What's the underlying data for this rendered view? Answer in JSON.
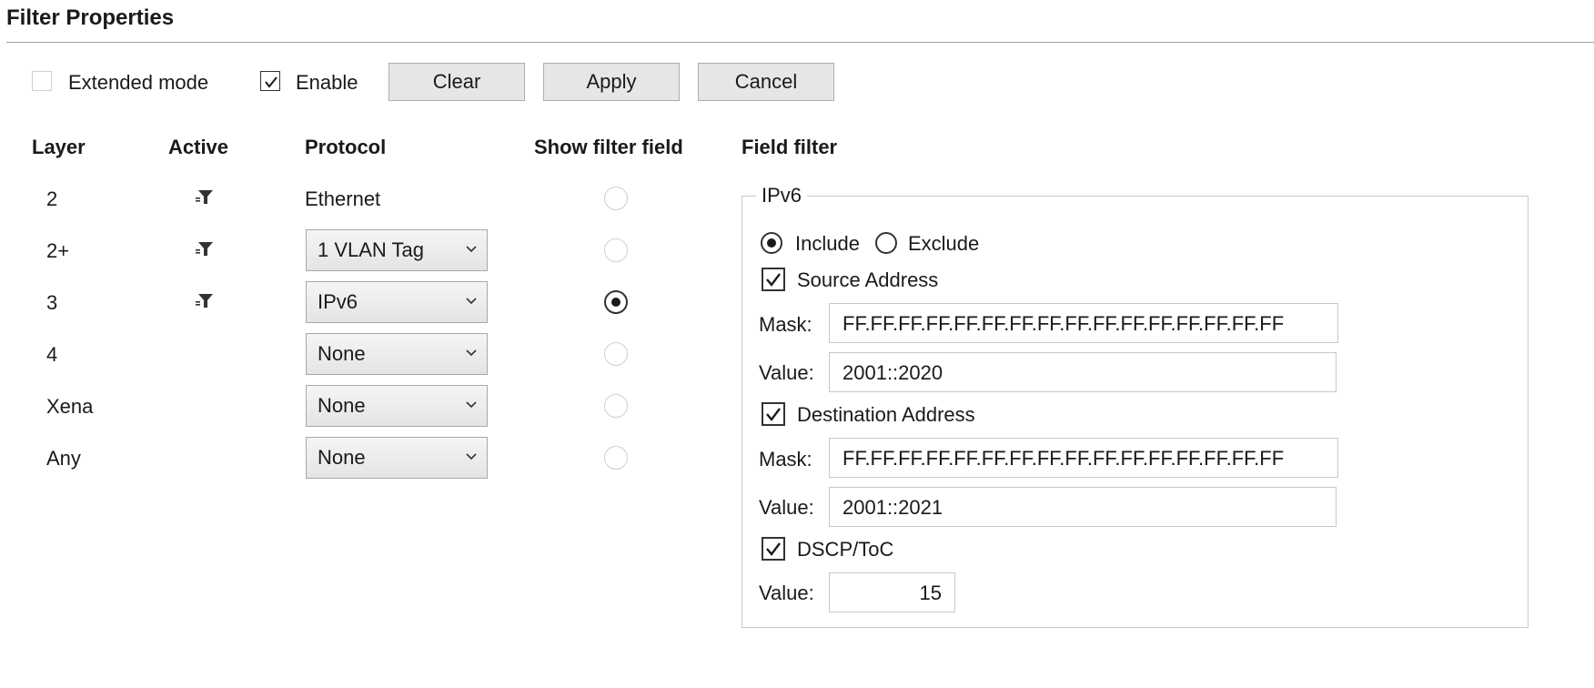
{
  "header": {
    "title": "Filter Properties"
  },
  "toolbar": {
    "extended_mode": {
      "label": "Extended mode",
      "checked": false
    },
    "enable": {
      "label": "Enable",
      "checked": true
    },
    "clear_label": "Clear",
    "apply_label": "Apply",
    "cancel_label": "Cancel"
  },
  "columns": {
    "layer": "Layer",
    "active": "Active",
    "protocol": "Protocol",
    "show_filter_field": "Show filter field",
    "field_filter": "Field filter"
  },
  "rows": [
    {
      "layer": "2",
      "active": true,
      "protocol": "Ethernet",
      "protocol_is_dropdown": false,
      "show_filter_field": false
    },
    {
      "layer": "2+",
      "active": true,
      "protocol": "1 VLAN Tag",
      "protocol_is_dropdown": true,
      "show_filter_field": false
    },
    {
      "layer": "3",
      "active": true,
      "protocol": "IPv6",
      "protocol_is_dropdown": true,
      "show_filter_field": true
    },
    {
      "layer": "4",
      "active": false,
      "protocol": "None",
      "protocol_is_dropdown": true,
      "show_filter_field": false
    },
    {
      "layer": "Xena",
      "active": false,
      "protocol": "None",
      "protocol_is_dropdown": true,
      "show_filter_field": false
    },
    {
      "layer": "Any",
      "active": false,
      "protocol": "None",
      "protocol_is_dropdown": true,
      "show_filter_field": false
    }
  ],
  "field_filter": {
    "group_title": "IPv6",
    "include_label": "Include",
    "exclude_label": "Exclude",
    "mode": "include",
    "source_address": {
      "label": "Source Address",
      "checked": true,
      "mask_label": "Mask:",
      "mask": "FF.FF.FF.FF.FF.FF.FF.FF.FF.FF.FF.FF.FF.FF.FF.FF",
      "value_label": "Value:",
      "value": "2001::2020"
    },
    "destination_address": {
      "label": "Destination Address",
      "checked": true,
      "mask_label": "Mask:",
      "mask": "FF.FF.FF.FF.FF.FF.FF.FF.FF.FF.FF.FF.FF.FF.FF.FF",
      "value_label": "Value:",
      "value": "2001::2021"
    },
    "dscp": {
      "label": "DSCP/ToC",
      "checked": true,
      "value_label": "Value:",
      "value": "15"
    }
  },
  "icons": {
    "active": "filter-funnel-icon",
    "dropdown": "chevron-down-icon",
    "check": "checkmark-icon"
  }
}
